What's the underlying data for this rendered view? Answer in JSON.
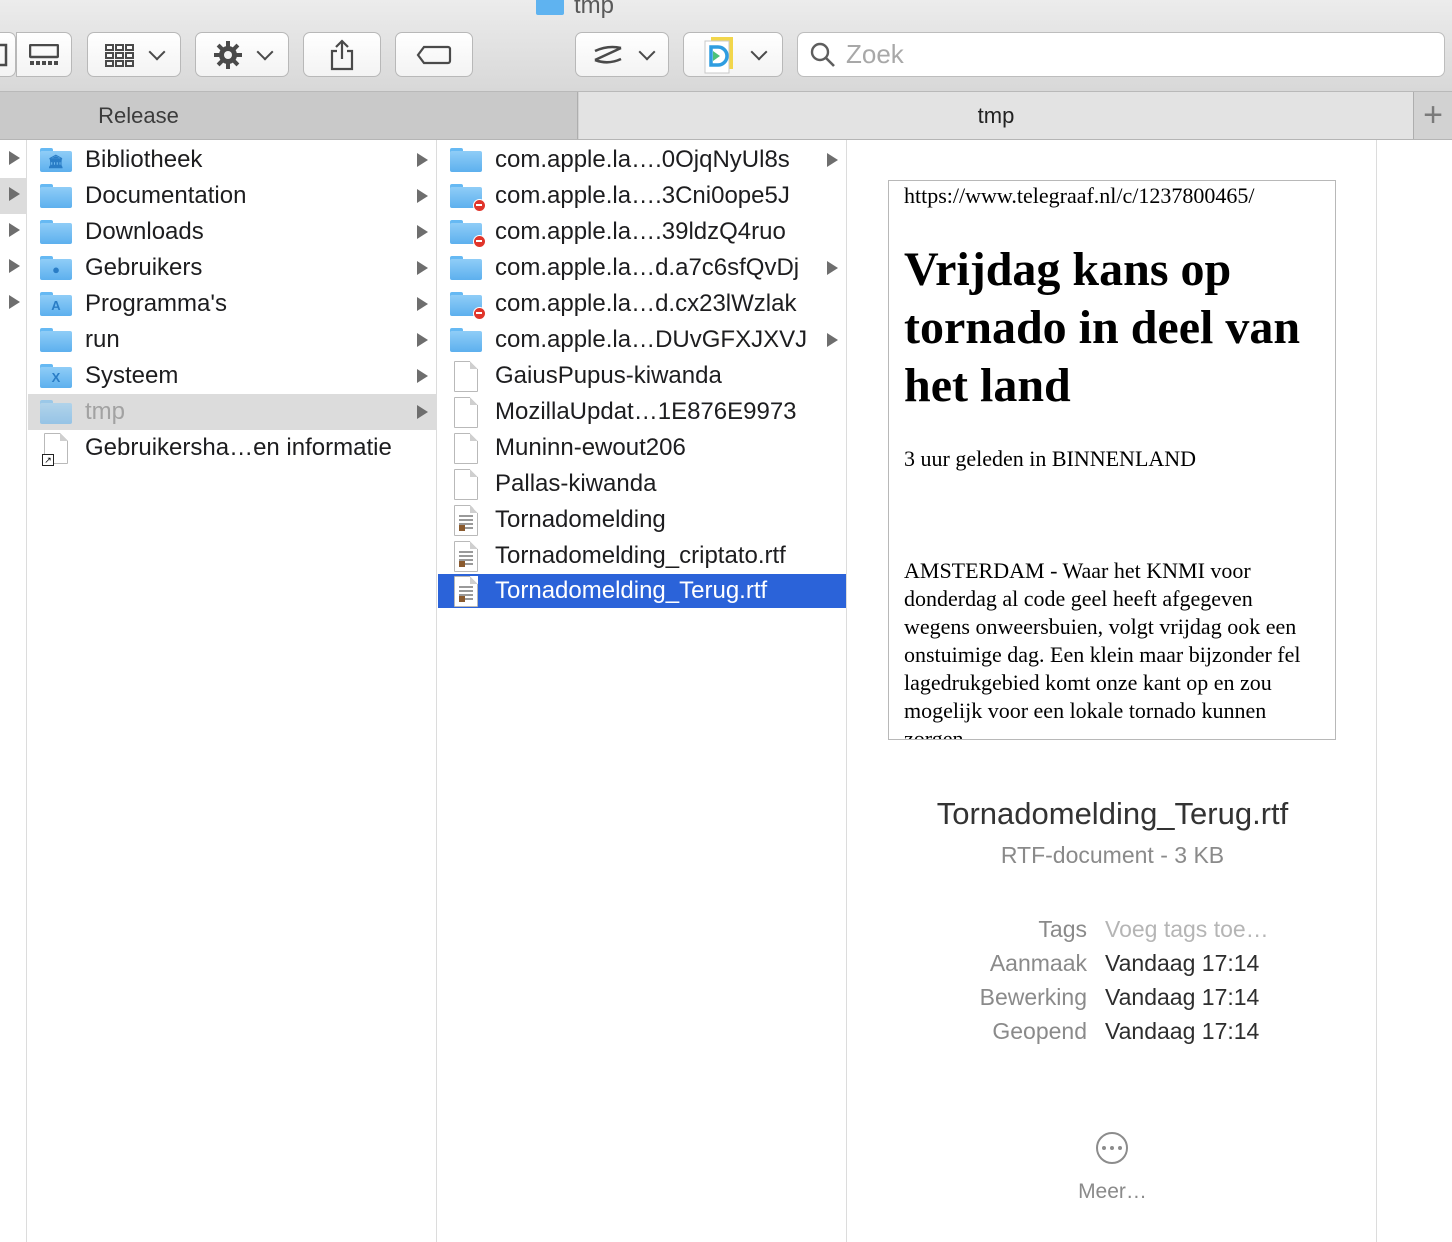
{
  "window": {
    "title": "tmp"
  },
  "toolbar": {
    "search_placeholder": "Zoek",
    "icons": [
      "column-view-icon",
      "gallery-view-icon",
      "group-icon",
      "gear-icon",
      "share-icon",
      "tag-icon",
      "app-s-icon",
      "app-d-icon",
      "search-icon"
    ]
  },
  "tabs": {
    "release": "Release",
    "tmp": "tmp",
    "add": "+"
  },
  "column1": {
    "items": [
      {
        "label": "Bibliotheek",
        "icon": "library-folder-icon"
      },
      {
        "label": "Documentation",
        "icon": "folder-icon"
      },
      {
        "label": "Downloads",
        "icon": "folder-icon"
      },
      {
        "label": "Gebruikers",
        "icon": "users-folder-icon"
      },
      {
        "label": "Programma's",
        "icon": "applications-folder-icon"
      },
      {
        "label": "run",
        "icon": "folder-icon"
      },
      {
        "label": "Systeem",
        "icon": "system-folder-icon"
      },
      {
        "label": "tmp",
        "icon": "alias-folder-icon"
      },
      {
        "label": "Gebruikersha…en informatie",
        "icon": "alias-document-icon"
      }
    ]
  },
  "column2": {
    "items": [
      {
        "label": "com.apple.la….0OjqNyUl8s"
      },
      {
        "label": "com.apple.la….3Cni0ope5J"
      },
      {
        "label": "com.apple.la….39ldzQ4ruo"
      },
      {
        "label": "com.apple.la…d.a7c6sfQvDj"
      },
      {
        "label": "com.apple.la…d.cx23lWzlak"
      },
      {
        "label": "com.apple.la…DUvGFXJXVJ"
      },
      {
        "label": "GaiusPupus-kiwanda"
      },
      {
        "label": "MozillaUpdat…1E876E9973"
      },
      {
        "label": "Muninn-ewout206"
      },
      {
        "label": "Pallas-kiwanda"
      },
      {
        "label": "Tornadomelding"
      },
      {
        "label": "Tornadomelding_criptato.rtf"
      },
      {
        "label": "Tornadomelding_Terug.rtf"
      }
    ]
  },
  "preview": {
    "url": "https://www.telegraaf.nl/c/1237800465/",
    "headline": "Vrijdag kans op tornado in deel van het land",
    "meta": "3 uur geleden in BINNENLAND",
    "body": "AMSTERDAM - Waar het KNMI voor donderdag al code geel heeft afgegeven wegens onweersbuien, volgt vrijdag ook een onstuimige dag. Een klein maar bijzonder fel lagedrukgebied komt onze kant op en zou mogelijk voor een lokale tornado kunnen zorgen.",
    "filename": "Tornadomelding_Terug.rtf",
    "kind": "RTF-document - 3 KB",
    "tags_label": "Tags",
    "tags_placeholder": "Voeg tags toe…",
    "created_label": "Aanmaak",
    "created_value": "Vandaag 17:14",
    "modified_label": "Bewerking",
    "modified_value": "Vandaag 17:14",
    "opened_label": "Geopend",
    "opened_value": "Vandaag 17:14",
    "more_label": "Meer…"
  },
  "colors": {
    "selection": "#2b63d9",
    "folder": "#5db0ee",
    "badge": "#e0352b"
  }
}
